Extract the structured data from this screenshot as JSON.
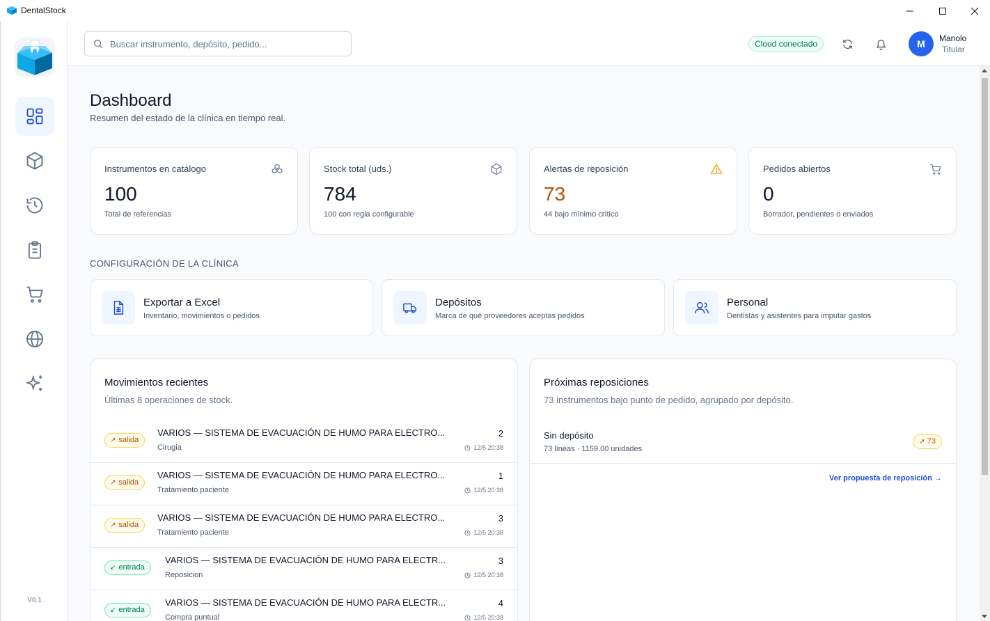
{
  "window": {
    "title": "DentalStock"
  },
  "sidebar": {
    "items": [
      {
        "name": "dashboard",
        "icon": "layout-grid-icon"
      },
      {
        "name": "inventory",
        "icon": "box-icon"
      },
      {
        "name": "history",
        "icon": "history-icon"
      },
      {
        "name": "orders",
        "icon": "clipboard-icon"
      },
      {
        "name": "cart",
        "icon": "cart-icon"
      },
      {
        "name": "web",
        "icon": "globe-icon"
      },
      {
        "name": "ai",
        "icon": "sparkles-icon"
      }
    ],
    "version": "V0.1"
  },
  "topbar": {
    "search_placeholder": "Buscar instrumento, depósito, pedido...",
    "cloud_status": "Cloud conectado",
    "user": {
      "initial": "M",
      "name": "Manolo",
      "role": "Titular"
    }
  },
  "page": {
    "title": "Dashboard",
    "subtitle": "Resumen del estado de la clínica en tiempo real."
  },
  "stats": [
    {
      "label": "Instrumentos en catálogo",
      "value": "100",
      "sub": "Total de referencias",
      "icon": "boxes-icon"
    },
    {
      "label": "Stock total (uds.)",
      "value": "784",
      "sub": "100 con regla configurable",
      "icon": "package-icon"
    },
    {
      "label": "Alertas de reposición",
      "value": "73",
      "sub": "44 bajo mínimo crítico",
      "icon": "warning-icon"
    },
    {
      "label": "Pedidos abiertos",
      "value": "0",
      "sub": "Borrador, pendientes o enviados",
      "icon": "cart-icon"
    }
  ],
  "config": {
    "heading": "CONFIGURACIÓN DE LA CLÍNICA",
    "cards": [
      {
        "title": "Exportar a Excel",
        "desc": "Inventario, movimientos o pedidos",
        "icon": "file-spreadsheet-icon"
      },
      {
        "title": "Depósitos",
        "desc": "Marca de qué proveedores aceptas pedidos",
        "icon": "truck-icon"
      },
      {
        "title": "Personal",
        "desc": "Dentistas y asistentes para imputar gastos",
        "icon": "users-icon"
      }
    ]
  },
  "movements": {
    "title": "Movimientos recientes",
    "subtitle": "Últimas 8 operaciones de stock.",
    "rows": [
      {
        "type": "salida",
        "name": "VARIOS — SISTEMA DE EVACUACIÓN DE HUMO PARA ELECTRO...",
        "note": "Cirugia",
        "qty": "2",
        "time": "12/5 20:38"
      },
      {
        "type": "salida",
        "name": "VARIOS — SISTEMA DE EVACUACIÓN DE HUMO PARA ELECTRO...",
        "note": "Tratamiento paciente",
        "qty": "1",
        "time": "12/5 20:38"
      },
      {
        "type": "salida",
        "name": "VARIOS — SISTEMA DE EVACUACIÓN DE HUMO PARA ELECTRO...",
        "note": "Tratamiento paciente",
        "qty": "3",
        "time": "12/5 20:38"
      },
      {
        "type": "entrada",
        "name": "VARIOS — SISTEMA DE EVACUACIÓN DE HUMO PARA ELECTR...",
        "note": "Reposicion",
        "qty": "3",
        "time": "12/5 20:38"
      },
      {
        "type": "entrada",
        "name": "VARIOS — SISTEMA DE EVACUACIÓN DE HUMO PARA ELECTR...",
        "note": "Compra puntual",
        "qty": "4",
        "time": "12/5 20:38"
      }
    ]
  },
  "replenish": {
    "title": "Próximas reposiciones",
    "subtitle": "73 instrumentos bajo punto de pedido, agrupado por depósito.",
    "rows": [
      {
        "name": "Sin depósito",
        "detail": "73 líneas · 1159.00 unidades",
        "count": "73"
      }
    ],
    "link": "Ver propuesta de reposición →"
  },
  "colors": {
    "accent": "#2563eb",
    "warning": "#b45309",
    "success": "#047857"
  }
}
